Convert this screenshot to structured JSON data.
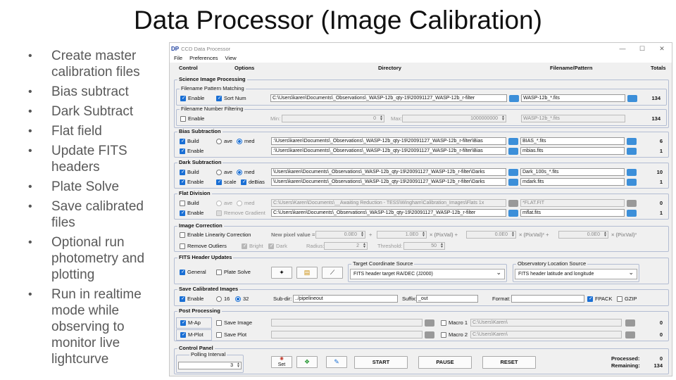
{
  "slide": {
    "title": "Data Processor (Image Calibration)",
    "bullets": [
      "Create master calibration files",
      "Bias subtract",
      "Dark Subtract",
      "Flat field",
      "Update FITS headers",
      "Plate Solve",
      "Save calibrated files",
      "Optional run photometry and plotting",
      "Run in realtime mode while observing to monitor live lightcurve"
    ]
  },
  "window": {
    "logo": "DP",
    "title": "CCD Data Processor",
    "minimize": "—",
    "maximize": "☐",
    "close": "✕"
  },
  "menu": [
    "File",
    "Preferences",
    "View"
  ],
  "columns": {
    "control": "Control",
    "options": "Options",
    "directory": "Directory",
    "filename": "Filename/Pattern",
    "totals": "Totals"
  },
  "science": {
    "title": "Science Image Processing",
    "pattern": {
      "title": "Filename Pattern Matching",
      "enable": "Enable",
      "sortnum": "Sort Num",
      "dir": "C:\\Users\\karen\\Documents\\_Observations\\_WASP-12b_qty-19\\20091127_WASP-12b_r-filter",
      "file": "WASP-12b_*.fits",
      "total": "134"
    },
    "number": {
      "title": "Filename Number Filtering",
      "enable": "Enable",
      "min_label": "Min:",
      "min_value": "0",
      "max_label": "Max:",
      "max_value": "1000000000",
      "file": "WASP-12b_*.fits",
      "total": "134"
    }
  },
  "bias": {
    "title": "Bias Subtraction",
    "build": "Build",
    "ave": "ave",
    "med": "med",
    "build_dir": ":\\Users\\karen\\Documents\\_Observations\\_WASP-12b_qty-19\\20091127_WASP-12b_r-filter\\Bias",
    "build_file": "BIAS_*.fits",
    "build_total": "6",
    "enable": "Enable",
    "enable_dir": ":\\Users\\karen\\Documents\\_Observations\\_WASP-12b_qty-19\\20091127_WASP-12b_r-filter\\Bias",
    "enable_file": "mbias.fits",
    "enable_total": "1"
  },
  "dark": {
    "title": "Dark Subtraction",
    "build": "Build",
    "ave": "ave",
    "med": "med",
    "build_dir": "\\Users\\karen\\Documents\\_Observations\\_WASP-12b_qty-19\\20091127_WASP-12b_r-filter\\Darks",
    "build_file": "Dark_100s_*.fits",
    "build_total": "10",
    "enable": "Enable",
    "scale": "scale",
    "debias": "deBias",
    "enable_dir": "\\Users\\karen\\Documents\\_Observations\\_WASP-12b_qty-19\\20091127_WASP-12b_r-filter\\Darks",
    "enable_file": "mdark.fits",
    "enable_total": "1"
  },
  "flat": {
    "title": "Flat Division",
    "build": "Build",
    "ave": "ave",
    "med": "med",
    "build_dir": "C:\\Users\\Karen\\Documents\\__Awaiting Reduction - TESS\\Wingham\\Calibration_Images\\Flats 1x",
    "build_file": "*FLAT.FIT",
    "build_total": "0",
    "enable": "Enable",
    "remove_gradient": "Remove Gradient",
    "enable_dir": "C:\\Users\\karen\\Documents\\_Observations\\_WASP-12b_qty-19\\20091127_WASP-12b_r-filter",
    "enable_file": "mflat.fits",
    "enable_total": "1"
  },
  "correction": {
    "title": "Image Correction",
    "linearity": "Enable Linearity Correction",
    "new_pixel": "New pixel value =",
    "c0": "0.0E0",
    "plus1": "+",
    "c1": "1.0E0",
    "term1": "× (PixVal) +",
    "c2": "0.0E0",
    "term2": "× (PixVal)² +",
    "c3": "0.0E0",
    "term3": "× (PixVal)³",
    "outliers": "Remove Outliers",
    "bright": "Bright",
    "dark": "Dark",
    "radius_label": "Radius:",
    "radius": "2",
    "threshold_label": "Threshold:",
    "threshold": "50"
  },
  "fits": {
    "title": "FITS Header Updates",
    "general": "General",
    "plate_solve": "Plate Solve",
    "target_title": "Target Coordinate Source",
    "target_value": "FITS header target RA/DEC (J2000)",
    "observatory_title": "Observatory Location Source",
    "observatory_value": "FITS header latitude and longitude"
  },
  "save": {
    "title": "Save Calibrated Images",
    "enable": "Enable",
    "b16": "16",
    "b32": "32",
    "subdir_label": "Sub-dir:",
    "subdir": "../pipelineout",
    "suffix_label": "Suffix:",
    "suffix": "_out",
    "format_label": "Format:",
    "format": "",
    "fpack": "FPACK",
    "gzip": "GZIP"
  },
  "post": {
    "title": "Post Processing",
    "map": "M-Ap",
    "mplot": "M-Plot",
    "save_image": "Save Image",
    "save_plot": "Save Plot",
    "macro1": "Macro 1",
    "macro1_dir": "C:\\Users\\Karen\\",
    "macro1_total": "0",
    "macro2": "Macro 2",
    "macro2_dir": "C:\\Users\\Karen\\",
    "macro2_total": "0"
  },
  "control": {
    "title": "Control Panel",
    "polling_title": "Polling Interval",
    "polling": "3",
    "set_label": "Set",
    "start": "START",
    "pause": "PAUSE",
    "reset": "RESET",
    "processed_label": "Processed:",
    "processed": "0",
    "remaining_label": "Remaining:",
    "remaining": "134"
  },
  "colors": {
    "accent": "#1a6fd4",
    "folder": "#3c8fd9",
    "group_border": "#b3bdd3"
  }
}
